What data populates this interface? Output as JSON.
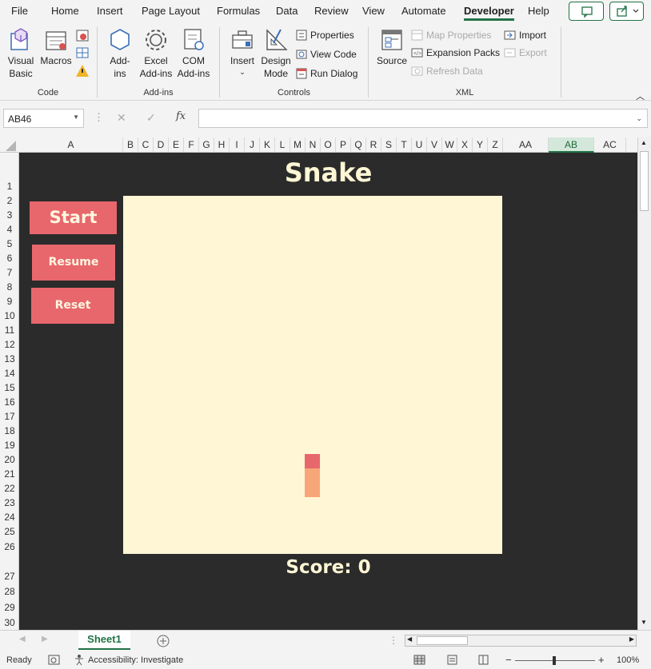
{
  "menu": {
    "tabs": [
      "File",
      "Home",
      "Insert",
      "Page Layout",
      "Formulas",
      "Data",
      "Review",
      "View",
      "Automate",
      "Developer",
      "Help"
    ],
    "active": "Developer"
  },
  "ribbon": {
    "code": {
      "label": "Code",
      "visual_basic": "Visual Basic",
      "macros": "Macros"
    },
    "addins": {
      "label": "Add-ins",
      "addins": "Add-ins",
      "excel_addins": "Excel Add-ins",
      "com_addins": "COM Add-ins"
    },
    "controls": {
      "label": "Controls",
      "insert": "Insert",
      "design_mode": "Design Mode",
      "properties": "Properties",
      "view_code": "View Code",
      "run_dialog": "Run Dialog"
    },
    "xml": {
      "label": "XML",
      "source": "Source",
      "map_properties": "Map Properties",
      "expansion_packs": "Expansion Packs",
      "refresh_data": "Refresh Data",
      "import": "Import",
      "export": "Export"
    }
  },
  "formula_bar": {
    "name_box": "AB46",
    "formula": ""
  },
  "columns": [
    "A",
    "B",
    "C",
    "D",
    "E",
    "F",
    "G",
    "H",
    "I",
    "J",
    "K",
    "L",
    "M",
    "N",
    "O",
    "P",
    "Q",
    "R",
    "S",
    "T",
    "U",
    "V",
    "W",
    "X",
    "Y",
    "Z",
    "AA",
    "AB",
    "AC"
  ],
  "selected_column": "AB",
  "rows": [
    "1",
    "2",
    "3",
    "4",
    "5",
    "6",
    "7",
    "8",
    "9",
    "10",
    "11",
    "12",
    "13",
    "14",
    "15",
    "16",
    "17",
    "18",
    "19",
    "20",
    "21",
    "22",
    "23",
    "24",
    "25",
    "26",
    "27",
    "28",
    "29",
    "30"
  ],
  "game": {
    "title": "Snake",
    "start_label": "Start",
    "resume_label": "Resume",
    "reset_label": "Reset",
    "score_text": "Score: 0",
    "head_color": "#e8676d",
    "body_color": "#f7a677",
    "board_color": "#fff6d5"
  },
  "sheet_tabs": {
    "active": "Sheet1"
  },
  "status": {
    "ready": "Ready",
    "accessibility": "Accessibility: Investigate",
    "zoom": "100%"
  }
}
